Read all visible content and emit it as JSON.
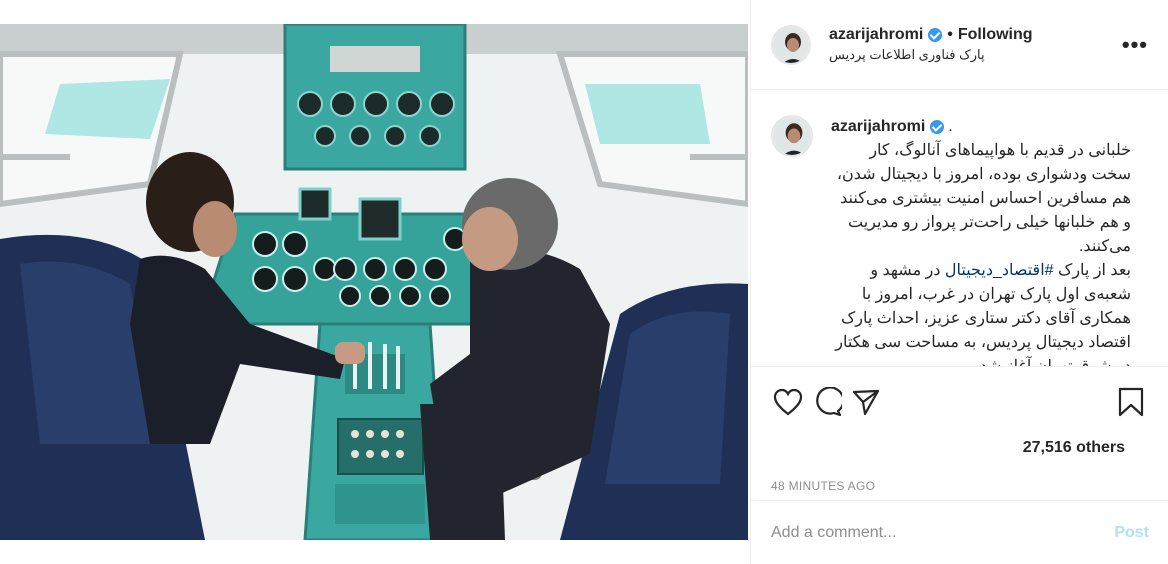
{
  "post": {
    "photo": {
      "subject": "cockpit-photo",
      "colors": {
        "panel": "#3aa8a0",
        "seat": "#1f2f55",
        "window": "#f3f6f6",
        "frame": "#d9dcdc"
      }
    },
    "header": {
      "username": "azarijahromi",
      "dot": "•",
      "follow_status": "Following",
      "location": "پارک فناوری اطلاعات پردیس",
      "more_label": "•••"
    },
    "caption": {
      "username": "azarijahromi",
      "trailing": ".",
      "paragraph1": "خلبانی در قدیم با هواپیماهای آنالوگ، کار سخت ودشواری بوده، امروز با دیجیتال شدن، هم مسافرین احساس امنیت بیشتری می‌کنند و هم خلبانها خیلی راحت‌تر پرواز رو مدیریت می‌کنند.",
      "p2_before": "بعد از پارک ",
      "hashtag": "#اقتصاد_دیجیتال",
      "p2_after": " در مشهد و شعبه‌ی اول پارک تهران در غرب، امروز با همکاری آقای دکتر ستاری عزیز، احداث پارک اقتصاد دیجیتال پردیس، به مساحت سی هکتار در شرق تهران آغاز شد."
    },
    "actions": {
      "like_icon": "heart-icon",
      "comment_icon": "comment-icon",
      "share_icon": "paper-plane-icon",
      "save_icon": "bookmark-icon"
    },
    "likes": "27,516 others",
    "timestamp": "48 MINUTES AGO",
    "comment_box": {
      "placeholder": "Add a comment...",
      "post_label": "Post"
    },
    "colors": {
      "link": "#00376b",
      "verified": "#3897f0",
      "muted": "#8e8e8e",
      "post_disabled": "#b2dffc"
    }
  }
}
